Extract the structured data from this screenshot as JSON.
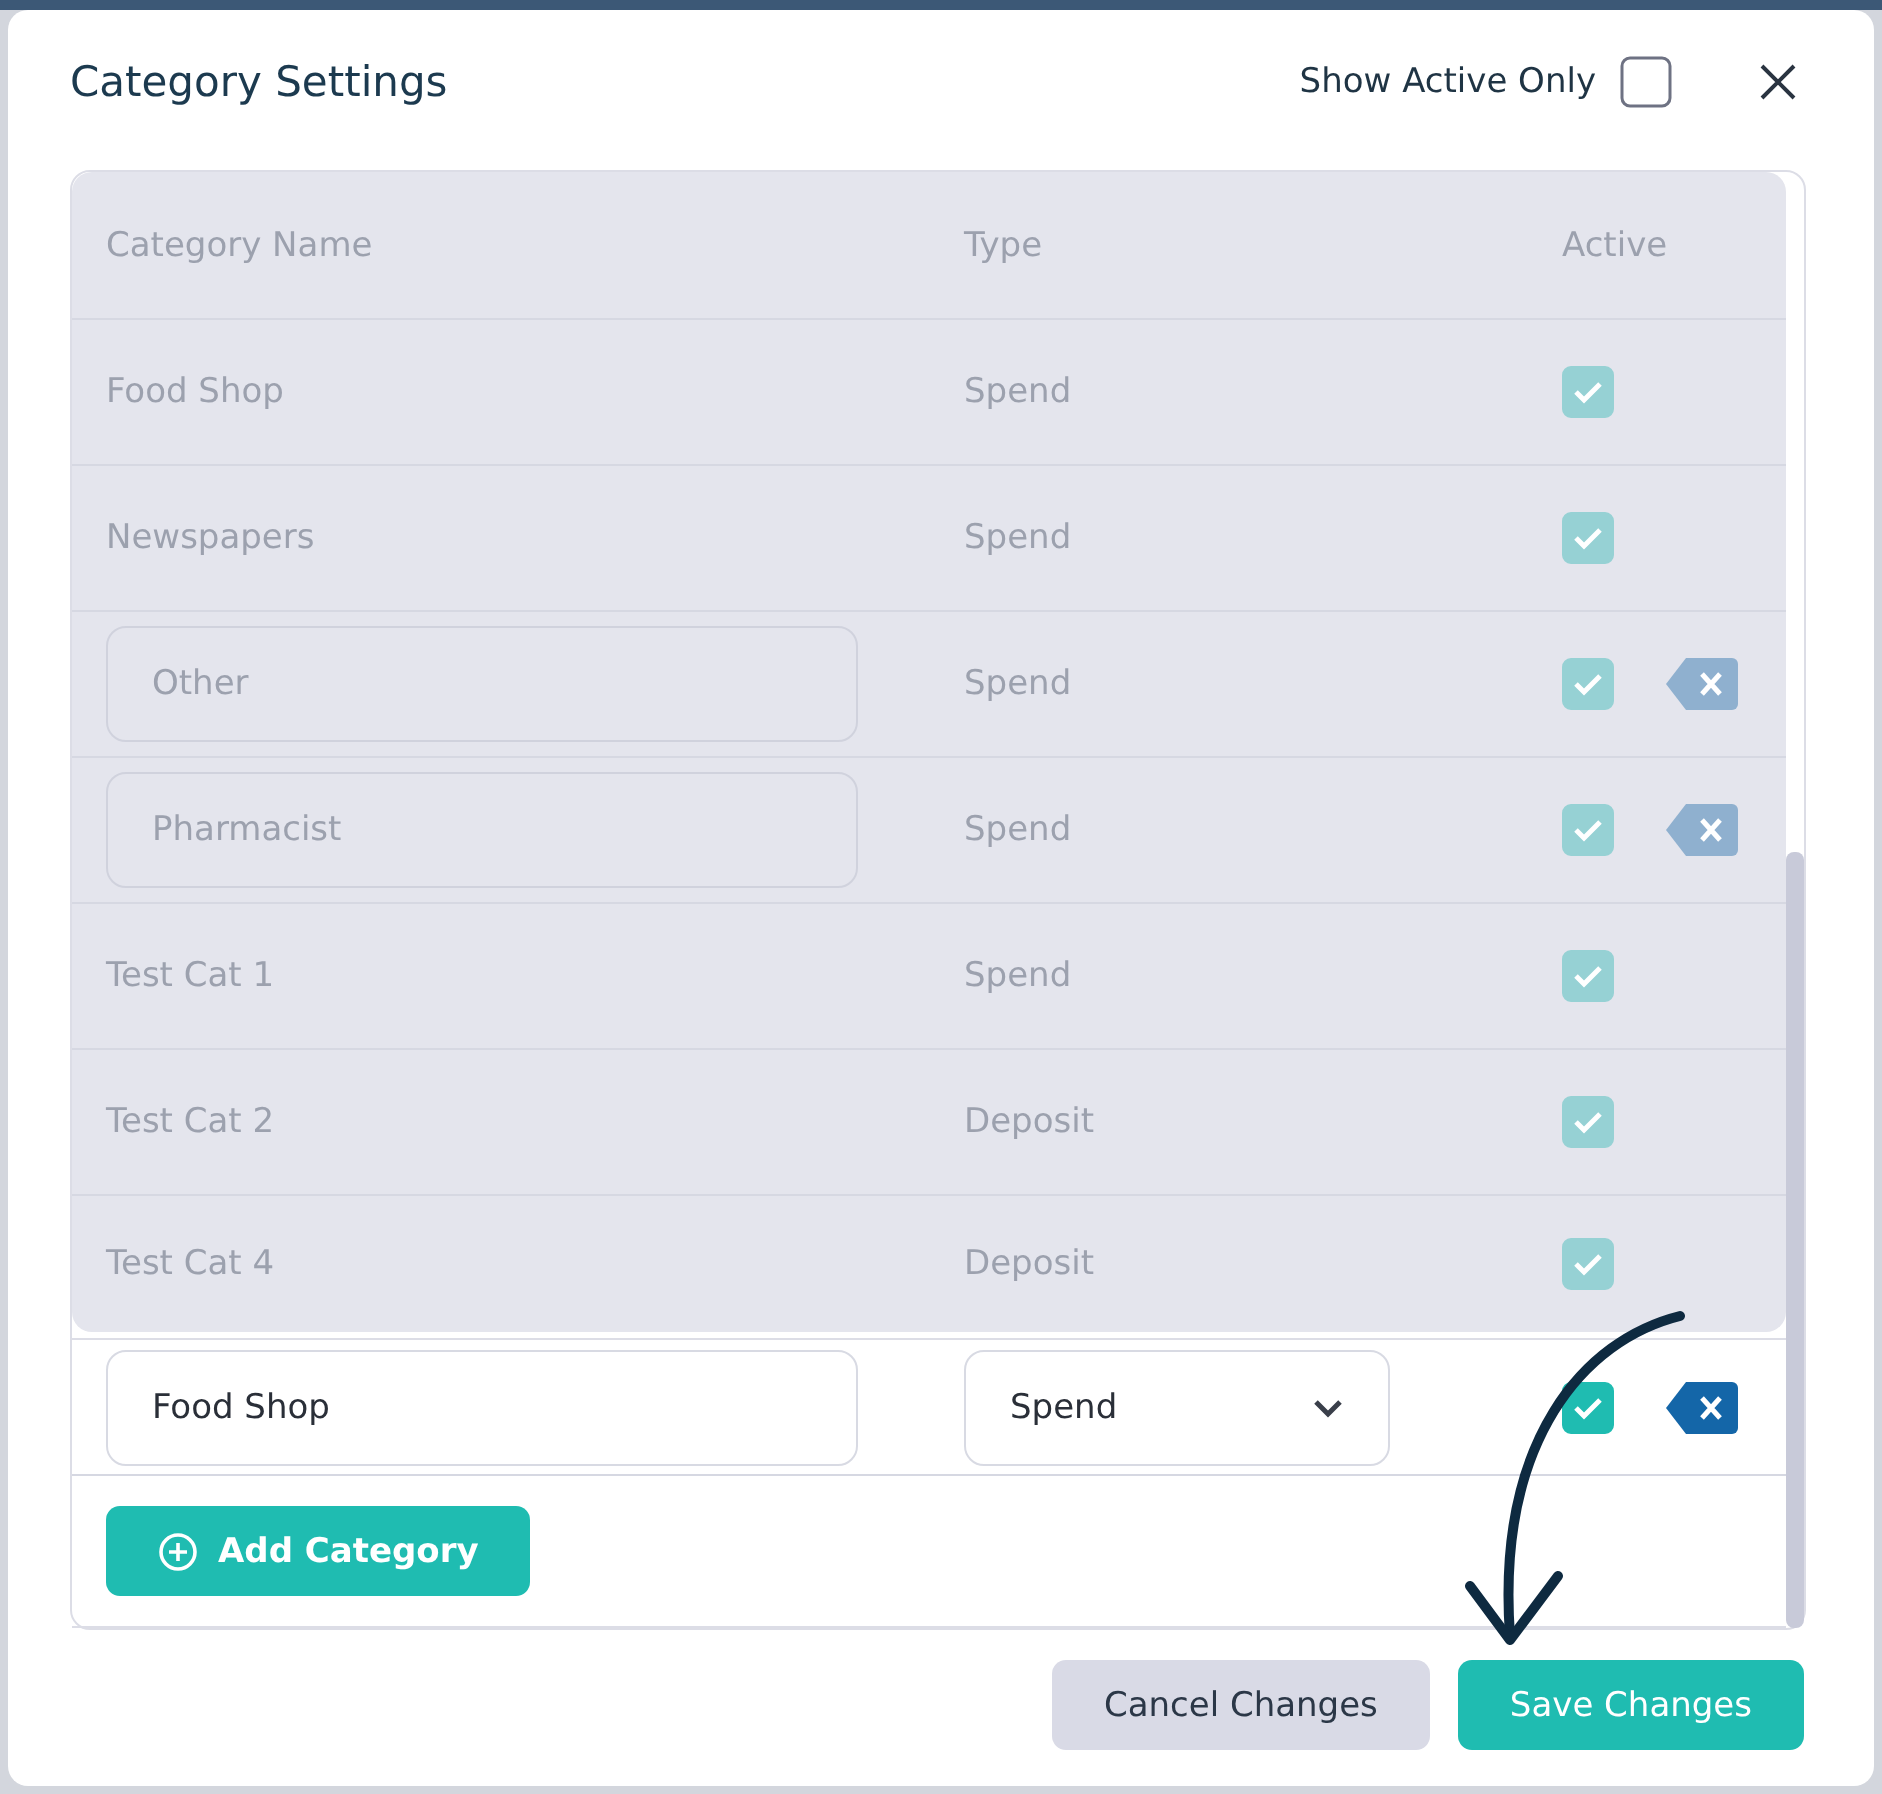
{
  "dialog": {
    "title": "Category Settings",
    "show_active_only": {
      "label": "Show Active Only",
      "checked": false
    }
  },
  "table": {
    "dimmed": true,
    "columns": [
      "Category Name",
      "Type",
      "Active"
    ],
    "rows": [
      {
        "kind": "text",
        "name": "Food Shop",
        "type": "Spend",
        "active": true
      },
      {
        "kind": "text",
        "name": "Newspapers",
        "type": "Spend",
        "active": true
      },
      {
        "kind": "input",
        "name": "Other",
        "type": "Spend",
        "active": true
      },
      {
        "kind": "input",
        "name": "Pharmacist",
        "type": "Spend",
        "active": true
      },
      {
        "kind": "text",
        "name": "Test Cat 1",
        "type": "Spend",
        "active": true
      },
      {
        "kind": "text",
        "name": "Test Cat 2",
        "type": "Deposit",
        "active": true
      },
      {
        "kind": "text",
        "name": "Test Cat 4",
        "type": "Deposit",
        "active": true
      }
    ]
  },
  "new_row": {
    "name": "Food Shop",
    "type": "Spend",
    "active": true
  },
  "add_button": {
    "label": "Add Category"
  },
  "footer": {
    "buttons": [
      {
        "kind": "secondary",
        "label": "Cancel Changes"
      },
      {
        "kind": "primary",
        "label": "Save Changes"
      }
    ]
  }
}
